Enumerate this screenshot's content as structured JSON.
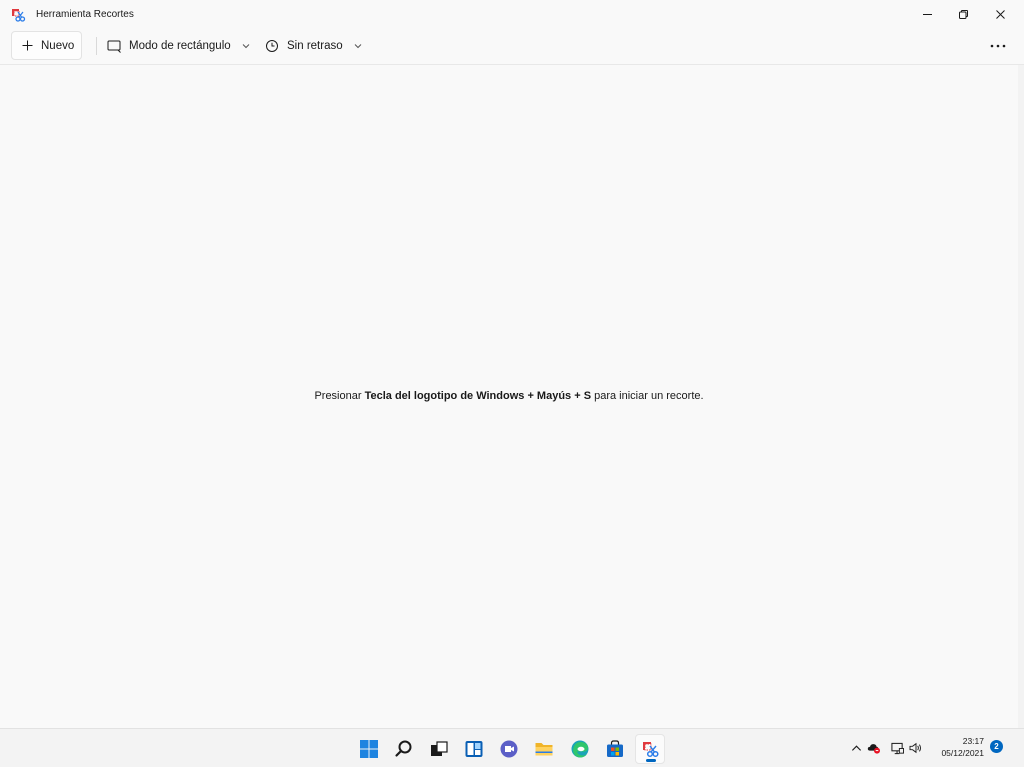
{
  "window": {
    "title": "Herramienta Recortes",
    "controls": {
      "minimize": "minimize",
      "maximize": "restore",
      "close": "close"
    }
  },
  "toolbar": {
    "new_label": "Nuevo",
    "mode_label": "Modo de rectángulo",
    "delay_label": "Sin retraso",
    "more_icon": "more-icon"
  },
  "main": {
    "hint_prefix": "Presionar ",
    "hint_bold": "Tecla del logotipo de Windows + Mayús + S",
    "hint_suffix": " para iniciar un recorte."
  },
  "taskbar": {
    "apps": [
      "start-icon",
      "search-icon",
      "task-view-icon",
      "widgets-icon",
      "teams-chat-icon",
      "file-explorer-icon",
      "edge-icon",
      "store-icon",
      "snipping-tool-icon"
    ],
    "active_app": "snipping-tool-icon"
  },
  "tray": {
    "time": "23:17",
    "date": "05/12/2021",
    "notification_count": "2"
  },
  "colors": {
    "accent": "#0067c0",
    "background": "#f9f9f9",
    "taskbar": "#f3f3f3"
  }
}
